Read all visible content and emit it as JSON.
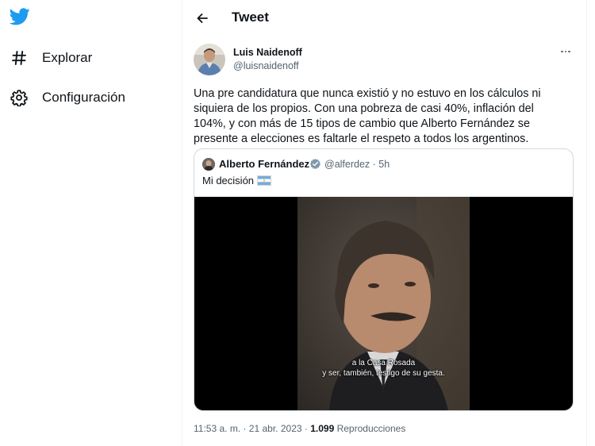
{
  "sidebar": {
    "logo": "twitter-bird-icon",
    "items": [
      {
        "icon": "hashtag-icon",
        "label": "Explorar"
      },
      {
        "icon": "gear-icon",
        "label": "Configuración"
      }
    ]
  },
  "header": {
    "back_icon": "arrow-left-icon",
    "title": "Tweet"
  },
  "tweet": {
    "author_name": "Luis Naidenoff",
    "author_handle": "@luisnaidenoff",
    "text": "Una pre candidatura que nunca existió y no estuvo en los cálculos ni siquiera de los propios. Con una pobreza de casi 40%, inflación del 104%, y con más de 15 tipos de cambio que Alberto Fernández se presente a elecciones es faltarle el respeto a todos los argentinos.",
    "quote": {
      "author_name": "Alberto Fernández",
      "author_handle": "@alferdez · 5h",
      "text": "Mi decisión",
      "video_caption_line1": "a la Casa Rosada",
      "video_caption_line2": "y ser, también, testigo de su gesta."
    },
    "time": "11:53 a. m. · 21 abr. 2023",
    "views_count": "1.099",
    "views_label": "Reproducciones"
  },
  "colors": {
    "brand": "#1d9bf0",
    "text": "#0f1419",
    "secondary": "#536471",
    "border": "#cfd9de"
  }
}
